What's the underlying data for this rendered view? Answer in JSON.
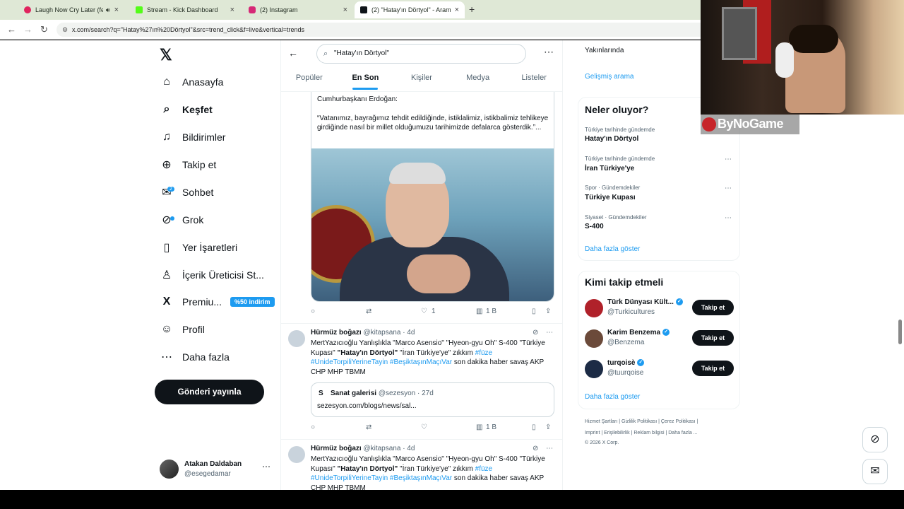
{
  "browser": {
    "tabs": [
      {
        "title": "Laugh Now Cry Later (feat.",
        "color": "#e0245e"
      },
      {
        "title": "Stream - Kick Dashboard",
        "color": "#53fc18"
      },
      {
        "title": "(2) Instagram",
        "color": "#d62976"
      },
      {
        "title": "(2) \"Hatay'ın Dörtyol\" - Arama /",
        "color": "#0f1419"
      }
    ],
    "url": "x.com/search?q=\"Hatay%27ın%20Dörtyol\"&src=trend_click&f=live&vertical=trends"
  },
  "nav": {
    "items": [
      {
        "label": "Anasayfa",
        "icon": "⌂",
        "name": "home"
      },
      {
        "label": "Keşfet",
        "icon": "⌕",
        "name": "explore"
      },
      {
        "label": "Bildirimler",
        "icon": "♫",
        "name": "notifications"
      },
      {
        "label": "Takip et",
        "icon": "⊕",
        "name": "follow"
      },
      {
        "label": "Sohbet",
        "icon": "✉",
        "name": "chat"
      },
      {
        "label": "Grok",
        "icon": "⊘",
        "name": "grok"
      },
      {
        "label": "Yer İşaretleri",
        "icon": "▯",
        "name": "bookmarks"
      },
      {
        "label": "İçerik Üreticisi St...",
        "icon": "♙",
        "name": "creator-studio"
      },
      {
        "label": "Premiu...",
        "icon": "X",
        "name": "premium"
      },
      {
        "label": "Profil",
        "icon": "☺",
        "name": "profile"
      },
      {
        "label": "Daha fazla",
        "icon": "⋯",
        "name": "more"
      }
    ],
    "chat_badge": "2",
    "premium_promo": "%50 indirim",
    "post_button": "Gönderi yayınla",
    "account": {
      "name": "Atakan Daldaban",
      "handle": "@esegedamar"
    }
  },
  "search": {
    "query": "\"Hatay'ın Dörtyol\""
  },
  "tabs": [
    "Popüler",
    "En Son",
    "Kişiler",
    "Medya",
    "Listeler"
  ],
  "feed": {
    "quote_intro": "Cumhurbaşkanı Erdoğan:",
    "quote_text": "“Vatanımız, bayrağımız tehdit edildiğinde, istiklalimiz, istikbalimiz tehlikeye girdiğinde nasıl bir millet olduğumuzu tarihimizde defalarca gösterdik.”...",
    "post1_actions": {
      "likes": "1",
      "views": "1 B"
    },
    "post2": {
      "name": "Hürmüz boğazı",
      "handle": "@kitapsana",
      "time": "· 4d",
      "text_a": "MertYazıcıoğlu Yanlışlıkla \"Marco Asensio\" \"Hyeon-gyu Oh\" S-400 \"Türkiye Kupası\" ",
      "bold1": "\"Hatay'ın Dörtyol\"",
      "text_b": " \"İran Türkiye'ye\" zıkkım ",
      "tag1": "#füze",
      "tag2": "#UnideTorpiliYerineTayin",
      "tag3": "#BeşiktaşınMaçıVar",
      "text_c": " son dakika haber savaş AKP CHP MHP TBMM",
      "card_name": "Sanat galerisi",
      "card_handle": "@sezesyon",
      "card_time": "· 27d",
      "card_link": "sezesyon.com/blogs/news/sal...",
      "views": "1 B"
    },
    "post3": {
      "name": "Hürmüz boğazı",
      "handle": "@kitapsana",
      "time": "· 4d"
    }
  },
  "right": {
    "near": "Yakınlarında",
    "advanced": "Gelişmiş arama",
    "trends_title": "Neler oluyor?",
    "trends": [
      {
        "sub": "Türkiye tarihinde gündemde",
        "topic": "Hatay'ın Dörtyol"
      },
      {
        "sub": "Türkiye tarihinde gündemde",
        "topic": "İran Türkiye'ye"
      },
      {
        "sub": "Spor · Gündemdekiler",
        "topic": "Türkiye Kupası"
      },
      {
        "sub": "Siyaset · Gündemdekiler",
        "topic": "S-400"
      }
    ],
    "show_more": "Daha fazla göster",
    "who_title": "Kimi takip etmeli",
    "who": [
      {
        "name": "Türk Dünyası Kült...",
        "handle": "@Turkicultures",
        "color": "#b0212a"
      },
      {
        "name": "Karim Benzema",
        "handle": "@Benzema",
        "color": "#6b4a3a"
      },
      {
        "name": "turqoisè",
        "handle": "@tuurqoise",
        "color": "#1c2b45"
      }
    ],
    "follow_label": "Takip et",
    "footer1": "Hizmet Şartları  |  Gizlilik Politikası  |  Çerez Politikası  |",
    "footer2": "Imprint  |  Erişilebilirlik  |  Reklam bilgisi  |  Daha fazla ...",
    "footer3": "© 2026 X Corp."
  },
  "overlay": {
    "brand": "ByNoGame"
  }
}
